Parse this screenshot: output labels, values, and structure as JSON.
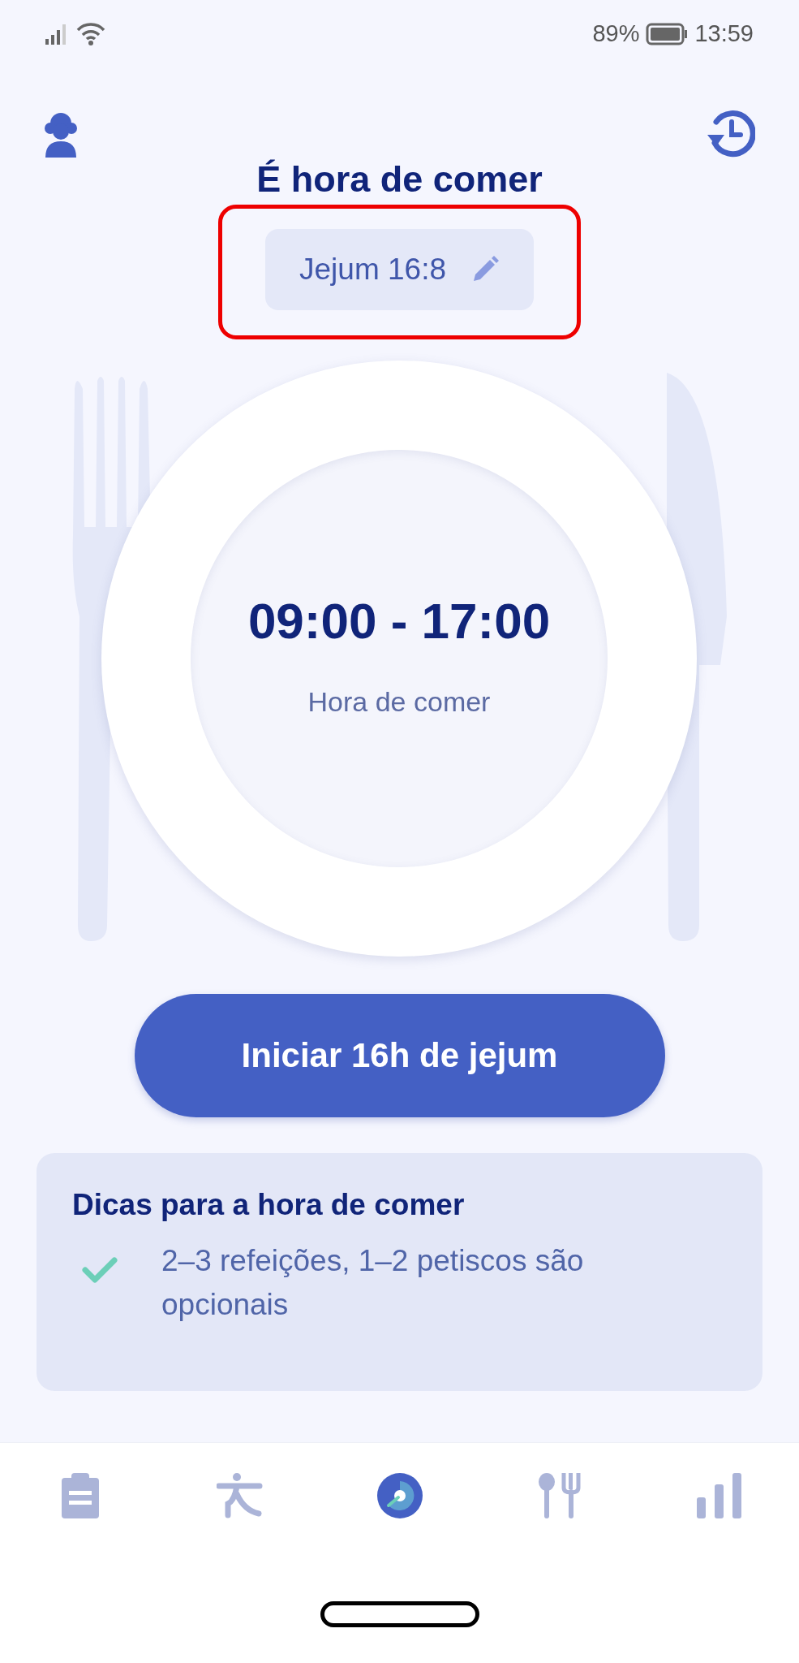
{
  "status_bar": {
    "battery": "89%",
    "time": "13:59"
  },
  "title": "É hora de comer",
  "plan_chip": {
    "label": "Jejum 16:8",
    "highlighted": true
  },
  "plate": {
    "time_range": "09:00 - 17:00",
    "caption": "Hora de comer"
  },
  "start_button": "Iniciar 16h de jejum",
  "tips": {
    "title": "Dicas para a hora de comer",
    "items": [
      {
        "text": "2–3 refeições, 1–2 petiscos são opcionais",
        "checked": true
      }
    ]
  },
  "nav_tabs": [
    {
      "kind": "clipboard",
      "selected": false
    },
    {
      "kind": "exercise",
      "selected": false
    },
    {
      "kind": "timer",
      "selected": true
    },
    {
      "kind": "meals",
      "selected": false
    },
    {
      "kind": "stats",
      "selected": false
    }
  ]
}
